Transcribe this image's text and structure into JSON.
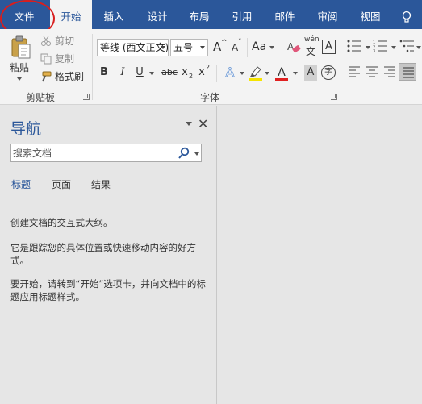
{
  "tabs": [
    "文件",
    "开始",
    "插入",
    "设计",
    "布局",
    "引用",
    "邮件",
    "审阅",
    "视图"
  ],
  "active_tab": 1,
  "clipboard": {
    "paste": "粘贴",
    "cut": "剪切",
    "copy": "复制",
    "format_painter": "格式刷",
    "label": "剪贴板"
  },
  "font": {
    "name": "等线 (西文正文)",
    "size": "五号",
    "grow": "A",
    "shrink": "A",
    "case": "Aa",
    "phonetic_top": "wén",
    "phonetic_bottom": "文",
    "border": "A",
    "bold": "B",
    "italic": "I",
    "underline": "U",
    "strike": "abc",
    "sub": "x",
    "sup": "x",
    "sub_mark": "2",
    "sup_mark": "2",
    "effect": "A",
    "color": "A",
    "shade": "A",
    "enclose": "字",
    "label": "字体",
    "highlight_color": "#f5e400",
    "font_color": "#e02020"
  },
  "nav": {
    "title": "导航",
    "close": "✕",
    "search_placeholder": "搜索文档",
    "tabs": [
      "标题",
      "页面",
      "结果"
    ],
    "msg1": "创建文档的交互式大纲。",
    "msg2": "它是跟踪您的具体位置或快速移动内容的好方式。",
    "msg3": "要开始，请转到“开始”选项卡，并向文档中的标题应用标题样式。"
  },
  "colors": {
    "accent": "#2b579a",
    "annotation": "#d81e1e"
  }
}
